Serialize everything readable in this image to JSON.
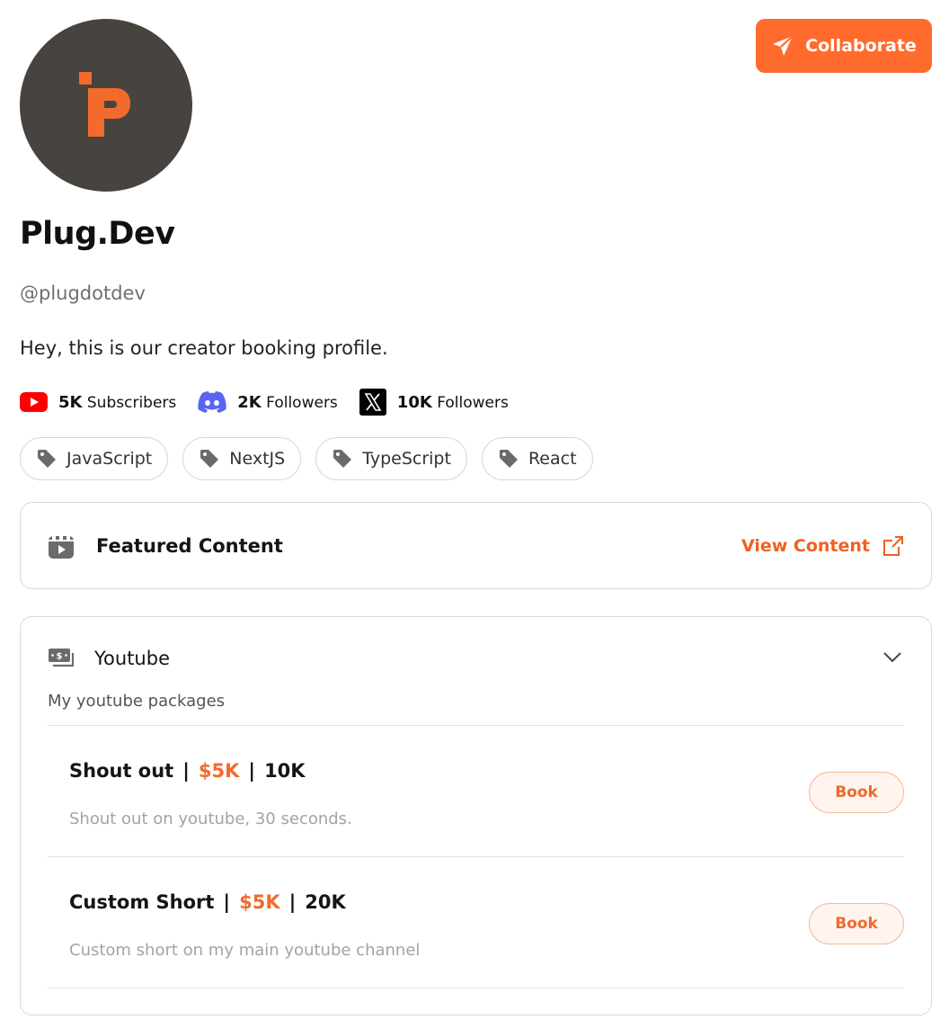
{
  "profile": {
    "name": "Plug.Dev",
    "handle": "@plugdotdev",
    "bio": "Hey, this is our creator booking profile."
  },
  "actions": {
    "collaborate_label": "Collaborate"
  },
  "socials": [
    {
      "icon": "youtube-icon",
      "count": "5K",
      "label": "Subscribers"
    },
    {
      "icon": "discord-icon",
      "count": "2K",
      "label": "Followers"
    },
    {
      "icon": "x-icon",
      "count": "10K",
      "label": "Followers"
    }
  ],
  "tags": [
    "JavaScript",
    "NextJS",
    "TypeScript",
    "React"
  ],
  "featured": {
    "title": "Featured Content",
    "link_label": "View Content"
  },
  "packages": {
    "platform": "Youtube",
    "subtitle": "My youtube packages",
    "items": [
      {
        "name": "Shout out",
        "price": "$5K",
        "reach": "10K",
        "description": "Shout out on youtube, 30 seconds.",
        "cta": "Book"
      },
      {
        "name": "Custom Short",
        "price": "$5K",
        "reach": "20K",
        "description": "Custom short on my main youtube channel",
        "cta": "Book"
      }
    ]
  },
  "colors": {
    "accent": "#ff6b2c",
    "avatar_bg": "#47433f",
    "youtube": "#ff0000",
    "discord": "#5865f2"
  }
}
